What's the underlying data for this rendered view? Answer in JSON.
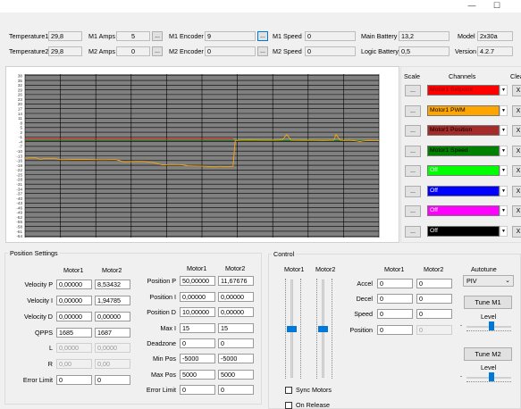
{
  "window": {
    "minimize": "—",
    "maximize": "☐"
  },
  "status": {
    "temperature1": {
      "label": "Temperature1",
      "value": "29,8"
    },
    "temperature2": {
      "label": "Temperature2",
      "value": "29,8"
    },
    "m1_amps": {
      "label": "M1 Amps",
      "value": "5"
    },
    "m2_amps": {
      "label": "M2 Amps",
      "value": "0"
    },
    "m1_encoder": {
      "label": "M1 Encoder",
      "value": "9"
    },
    "m2_encoder": {
      "label": "M2 Encoder",
      "value": "0"
    },
    "m1_speed": {
      "label": "M1 Speed",
      "value": "0"
    },
    "m2_speed": {
      "label": "M2 Speed",
      "value": "0"
    },
    "main_battery": {
      "label": "Main Battery",
      "value": "13,2"
    },
    "logic_battery": {
      "label": "Logic Battery",
      "value": "0,5"
    },
    "model": {
      "label": "Model",
      "value": "2x30a"
    },
    "version": {
      "label": "Version",
      "value": "4.2.7"
    },
    "dots": "..."
  },
  "chart_data": {
    "type": "line",
    "yticks": [
      "38",
      "35",
      "32",
      "29",
      "26",
      "23",
      "20",
      "17",
      "14",
      "11",
      "8",
      "5",
      "2",
      "-1",
      "-4",
      "-7",
      "-10",
      "-13",
      "-16",
      "-19",
      "-22",
      "-25",
      "-28",
      "-31",
      "-34",
      "-37",
      "-40",
      "-43",
      "-46",
      "-49",
      "-52",
      "-55",
      "-58",
      "-61",
      "-64"
    ],
    "ylim": [
      -65,
      39
    ],
    "x_count": 330,
    "grid": true,
    "background": "#808080",
    "series": [
      {
        "name": "Motor1 Setpoint",
        "color": "#ff0000",
        "x": [
          0,
          194
        ],
        "y": [
          -2.3,
          -2.3
        ]
      },
      {
        "name": "Motor1 Speed",
        "color": "#008000",
        "x": [
          0,
          330
        ],
        "y": [
          -3.4,
          -3.4
        ]
      },
      {
        "name": "Motor1 PWM",
        "color": "#ffa500",
        "x": [
          0,
          10,
          14,
          18,
          28,
          34,
          44,
          58,
          72,
          84,
          92,
          104,
          110,
          120,
          128,
          136,
          146,
          152,
          158,
          166,
          172,
          178,
          182,
          186,
          190,
          194,
          196,
          200,
          210,
          220,
          234,
          240,
          244,
          248,
          254,
          260,
          268,
          278,
          288,
          290,
          294,
          298,
          302,
          306,
          312,
          320,
          330
        ],
        "y": [
          -14.5,
          -14.2,
          -15.2,
          -14.8,
          -14.8,
          -15.5,
          -15.3,
          -15.3,
          -15.6,
          -15.4,
          -16.8,
          -16.6,
          -16.6,
          -17.3,
          -18.8,
          -18.5,
          -18.6,
          -19.3,
          -19.4,
          -19.5,
          -19.8,
          -20.0,
          -19.6,
          -19.9,
          -19.8,
          -19.6,
          -3.2,
          -3.0,
          -2.9,
          -3.0,
          -3.0,
          -2.8,
          0.5,
          -3.0,
          -3.1,
          -3.0,
          -3.1,
          -3.2,
          -3.0,
          0.5,
          -3.0,
          -3.2,
          -3.1,
          -3.3,
          -3.9,
          -3.2,
          -3.4
        ]
      }
    ]
  },
  "channels_panel": {
    "scale_header": "Scale",
    "channels_header": "Channels",
    "clear_header": "Clear",
    "dots": "...",
    "x": "X",
    "arrow": "▼",
    "items": [
      {
        "name": "Motor1 Setpoint",
        "bg": "#ff0000",
        "fg": "#8b0000"
      },
      {
        "name": "Motor1 PWM",
        "bg": "#ffa500",
        "fg": "#000000"
      },
      {
        "name": "Motor1 Position",
        "bg": "#a52a2a",
        "fg": "#000000"
      },
      {
        "name": "Motor1 Speed",
        "bg": "#008000",
        "fg": "#000000"
      },
      {
        "name": "Off",
        "bg": "#00ff00",
        "fg": "#ffffff"
      },
      {
        "name": "Off",
        "bg": "#0000ff",
        "fg": "#ffffff"
      },
      {
        "name": "Off",
        "bg": "#ff00ff",
        "fg": "#ffffff"
      },
      {
        "name": "Off",
        "bg": "#000000",
        "fg": "#ffffff"
      }
    ]
  },
  "position_settings": {
    "title": "Position Settings",
    "motor1_header": "Motor1",
    "motor2_header": "Motor2",
    "rows": [
      {
        "label": "Velocity P",
        "m1": "0,00000",
        "m2": "8,53432"
      },
      {
        "label": "Velocity I",
        "m1": "0,00000",
        "m2": "1,94785"
      },
      {
        "label": "Velocity D",
        "m1": "0,00000",
        "m2": "0,00000"
      },
      {
        "label": "QPPS",
        "m1": "1685",
        "m2": "1687"
      },
      {
        "label": "L",
        "m1": "0,0000",
        "m2": "0,0000"
      },
      {
        "label": "R",
        "m1": "0,00",
        "m2": "0,00"
      },
      {
        "label": "Error Limit",
        "m1": "0",
        "m2": "0"
      }
    ],
    "rows2": [
      {
        "label": "Position P",
        "m1": "50,00000",
        "m2": "11,67676"
      },
      {
        "label": "Position I",
        "m1": "0,00000",
        "m2": "0,00000"
      },
      {
        "label": "Position D",
        "m1": "10,00000",
        "m2": "0,00000"
      },
      {
        "label": "Max I",
        "m1": "15",
        "m2": "15"
      },
      {
        "label": "Deadzone",
        "m1": "0",
        "m2": "0"
      },
      {
        "label": "Min Pos",
        "m1": "-5000",
        "m2": "-5000"
      },
      {
        "label": "Max Pos",
        "m1": "5000",
        "m2": "5000"
      },
      {
        "label": "Error Limit",
        "m1": "0",
        "m2": "0"
      }
    ]
  },
  "control": {
    "title": "Control",
    "slider_m1_label": "Motor1",
    "slider_m2_label": "Motor2",
    "motor1_header": "Motor1",
    "motor2_header": "Motor2",
    "rows": [
      {
        "label": "Accel",
        "m1": "0",
        "m2": "0"
      },
      {
        "label": "Decel",
        "m1": "0",
        "m2": "0"
      },
      {
        "label": "Speed",
        "m1": "0",
        "m2": "0"
      },
      {
        "label": "Position",
        "m1": "0",
        "m2": "0"
      }
    ],
    "sync_motors": "Sync Motors",
    "on_release": "On Release",
    "autotune_label": "Autotune",
    "autotune_value": "PIV",
    "tune_m1": "Tune M1",
    "tune_m2": "Tune M2",
    "level_label": "Level",
    "slider_m1_level": 0.5,
    "slider_m2_level": 0.5,
    "level1": 0.55,
    "level2": 0.55
  }
}
